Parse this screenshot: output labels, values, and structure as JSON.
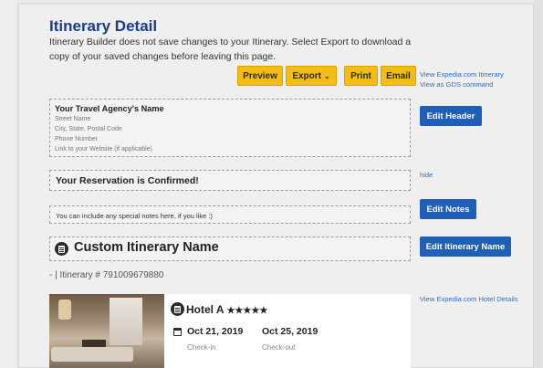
{
  "header": {
    "title": "Itinerary Detail",
    "subtitle": "Itinerary Builder does not save changes to your Itinerary. Select Export to download a copy of your saved changes before leaving this page."
  },
  "toolbar": {
    "preview": "Preview",
    "export": "Export",
    "print": "Print",
    "email": "Email"
  },
  "top_links": {
    "view_itinerary": "View Expedia.com Itinerary",
    "view_gds": "View as GDS command"
  },
  "agency": {
    "name": "Your Travel Agency's Name",
    "lines": [
      "Street Name",
      "City, State, Postal Code",
      "Phone Number",
      "Link to your Website (if applicable)"
    ],
    "edit_button": "Edit Header"
  },
  "reservation": {
    "text": "Your Reservation is Confirmed!",
    "hide_link": "hide"
  },
  "notes": {
    "text": "You can include any special notes here, if you like :)",
    "edit_button": "Edit Notes"
  },
  "itinerary": {
    "name": "Custom Itinerary Name",
    "edit_button": "Edit Itinerary Name",
    "number_line": "- | Itinerary # 791009679880"
  },
  "hotel": {
    "name": "Hotel A",
    "stars": "★★★★★",
    "checkin_date": "Oct 21, 2019",
    "checkin_label": "Check-in",
    "checkout_date": "Oct 25, 2019",
    "checkout_label": "Check-out",
    "details_link": "View Expedia.com Hotel Details"
  },
  "colors": {
    "accent_yellow": "#f4bd15",
    "button_blue": "#1f5fb8",
    "title_blue": "#1b3d87",
    "link_blue": "#2c6fc2"
  }
}
